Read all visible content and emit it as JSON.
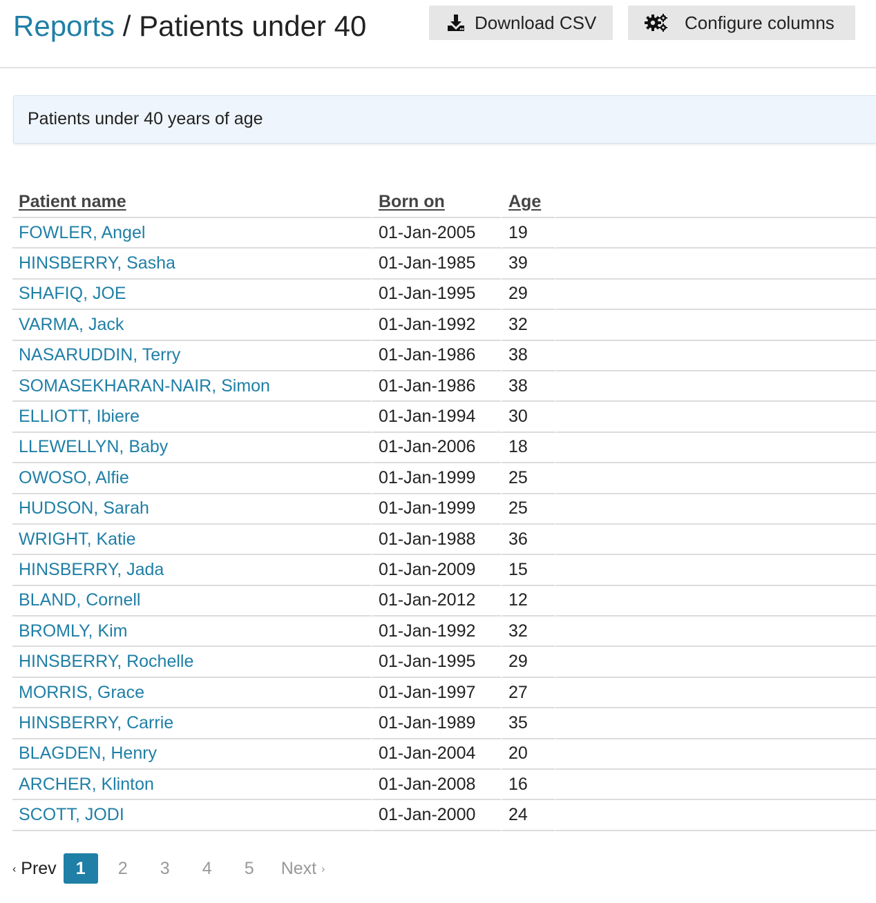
{
  "header": {
    "breadcrumb_link": "Reports",
    "breadcrumb_sep": " / ",
    "title": "Patients under 40",
    "download_label": "Download CSV",
    "configure_label": "Configure columns"
  },
  "info": {
    "text": "Patients under 40 years of age"
  },
  "table": {
    "columns": [
      "Patient name",
      "Born on",
      "Age"
    ],
    "rows": [
      {
        "name": "FOWLER, Angel",
        "born": "01-Jan-2005",
        "age": "19"
      },
      {
        "name": "HINSBERRY, Sasha",
        "born": "01-Jan-1985",
        "age": "39"
      },
      {
        "name": "SHAFIQ, JOE",
        "born": "01-Jan-1995",
        "age": "29"
      },
      {
        "name": "VARMA, Jack",
        "born": "01-Jan-1992",
        "age": "32"
      },
      {
        "name": "NASARUDDIN, Terry",
        "born": "01-Jan-1986",
        "age": "38"
      },
      {
        "name": "SOMASEKHARAN-NAIR, Simon",
        "born": "01-Jan-1986",
        "age": "38"
      },
      {
        "name": "ELLIOTT, Ibiere",
        "born": "01-Jan-1994",
        "age": "30"
      },
      {
        "name": "LLEWELLYN, Baby",
        "born": "01-Jan-2006",
        "age": "18"
      },
      {
        "name": "OWOSO, Alfie",
        "born": "01-Jan-1999",
        "age": "25"
      },
      {
        "name": "HUDSON, Sarah",
        "born": "01-Jan-1999",
        "age": "25"
      },
      {
        "name": "WRIGHT, Katie",
        "born": "01-Jan-1988",
        "age": "36"
      },
      {
        "name": "HINSBERRY, Jada",
        "born": "01-Jan-2009",
        "age": "15"
      },
      {
        "name": "BLAND, Cornell",
        "born": "01-Jan-2012",
        "age": "12"
      },
      {
        "name": "BROMLY, Kim",
        "born": "01-Jan-1992",
        "age": "32"
      },
      {
        "name": "HINSBERRY, Rochelle",
        "born": "01-Jan-1995",
        "age": "29"
      },
      {
        "name": "MORRIS, Grace",
        "born": "01-Jan-1997",
        "age": "27"
      },
      {
        "name": "HINSBERRY, Carrie",
        "born": "01-Jan-1989",
        "age": "35"
      },
      {
        "name": "BLAGDEN, Henry",
        "born": "01-Jan-2004",
        "age": "20"
      },
      {
        "name": "ARCHER, Klinton",
        "born": "01-Jan-2008",
        "age": "16"
      },
      {
        "name": "SCOTT, JODI",
        "born": "01-Jan-2000",
        "age": "24"
      }
    ]
  },
  "pagination": {
    "prev_label": "Prev",
    "next_label": "Next",
    "pages": [
      "1",
      "2",
      "3",
      "4",
      "5"
    ],
    "current": "1"
  },
  "icons": {
    "download": "download-icon",
    "configure": "gears-icon"
  },
  "colors": {
    "link": "#1f7fa6",
    "active_page": "#1f7fa6",
    "button_bg": "#e6e6e6",
    "info_bg": "#eef5fc"
  }
}
